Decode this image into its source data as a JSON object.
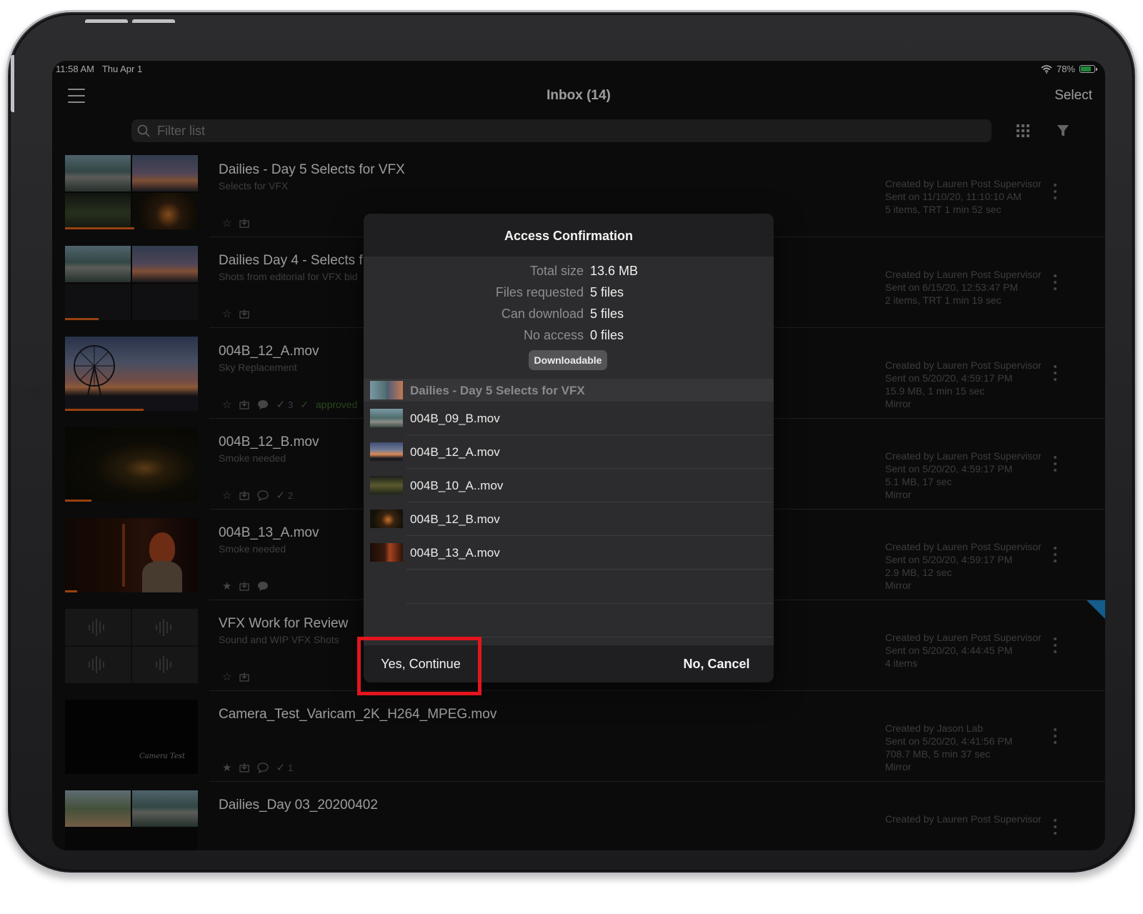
{
  "status_bar": {
    "time": "11:58 AM",
    "date": "Thu Apr 1",
    "battery": "78%",
    "battery_level": 0.78
  },
  "nav": {
    "title": "Inbox (14)",
    "select_label": "Select"
  },
  "search": {
    "placeholder": "Filter list"
  },
  "colors": {
    "accent_orange": "#e8651a",
    "highlight_red": "#e3151d",
    "flag_blue": "#1e8ed8",
    "battery_green": "#30d158"
  },
  "rows": [
    {
      "title": "Dailies - Day 5 Selects for VFX",
      "subtitle": "Selects for VFX",
      "meta": [
        "Created by Lauren Post Supervisor",
        "Sent on 11/10/20, 11:10:10 AM",
        "5 items, TRT 1 min 52 sec"
      ],
      "progress": 0.52
    },
    {
      "title": "Dailies Day 4 - Selects f",
      "subtitle": "Shots from editorial for VFX bid",
      "meta": [
        "Created by Lauren Post Supervisor",
        "Sent on 6/15/20, 12:53:47 PM",
        "2 items, TRT 1 min 19 sec"
      ],
      "progress": 0.25
    },
    {
      "title": "004B_12_A.mov",
      "subtitle": "Sky Replacement",
      "comments_count": "3",
      "approved_label": "approved",
      "meta": [
        "Created by Lauren Post Supervisor",
        "Sent on 5/20/20, 4:59:17 PM",
        "15.9 MB, 1 min 15 sec",
        "Mirror"
      ],
      "progress": 0.59
    },
    {
      "title": "004B_12_B.mov",
      "subtitle": "Smoke needed",
      "comments_count": "2",
      "meta": [
        "Created by Lauren Post Supervisor",
        "Sent on 5/20/20, 4:59:17 PM",
        "5.1 MB, 17 sec",
        "Mirror"
      ],
      "progress": 0.2
    },
    {
      "title": "004B_13_A.mov",
      "subtitle": "Smoke needed",
      "meta": [
        "Created by Lauren Post Supervisor",
        "Sent on 5/20/20, 4:59:17 PM",
        "2.9 MB, 12 sec",
        "Mirror"
      ],
      "progress": 0.09
    },
    {
      "title": "VFX Work for Review",
      "subtitle": "Sound and WIP VFX Shots",
      "meta": [
        "Created by Lauren Post Supervisor",
        "Sent on 5/20/20, 4:44:45 PM",
        "4 items"
      ]
    },
    {
      "title": "Camera_Test_Varicam_2K_H264_MPEG.mov",
      "subtitle": "",
      "comments_count": "1",
      "thumb_caption": "Camera Test",
      "meta": [
        "Created by Jason Lab",
        "Sent on 5/20/20, 4:41:56 PM",
        "708.7 MB, 5 min 37 sec",
        "Mirror"
      ]
    },
    {
      "title": "Dailies_Day 03_20200402",
      "subtitle": "",
      "meta": [
        "Created by Lauren Post Supervisor"
      ]
    }
  ],
  "modal": {
    "title": "Access Confirmation",
    "total_size_label": "Total size",
    "total_size": "13.6 MB",
    "files_requested_label": "Files requested",
    "files_requested": "5 files",
    "can_download_label": "Can download",
    "can_download": "5 files",
    "no_access_label": "No access",
    "no_access": "0 files",
    "badge": "Downloadable",
    "group_title": "Dailies - Day 5 Selects for VFX",
    "files": [
      "004B_09_B.mov",
      "004B_12_A.mov",
      "004B_10_A..mov",
      "004B_12_B.mov",
      "004B_13_A.mov"
    ],
    "yes_label": "Yes, Continue",
    "no_label": "No, Cancel"
  }
}
